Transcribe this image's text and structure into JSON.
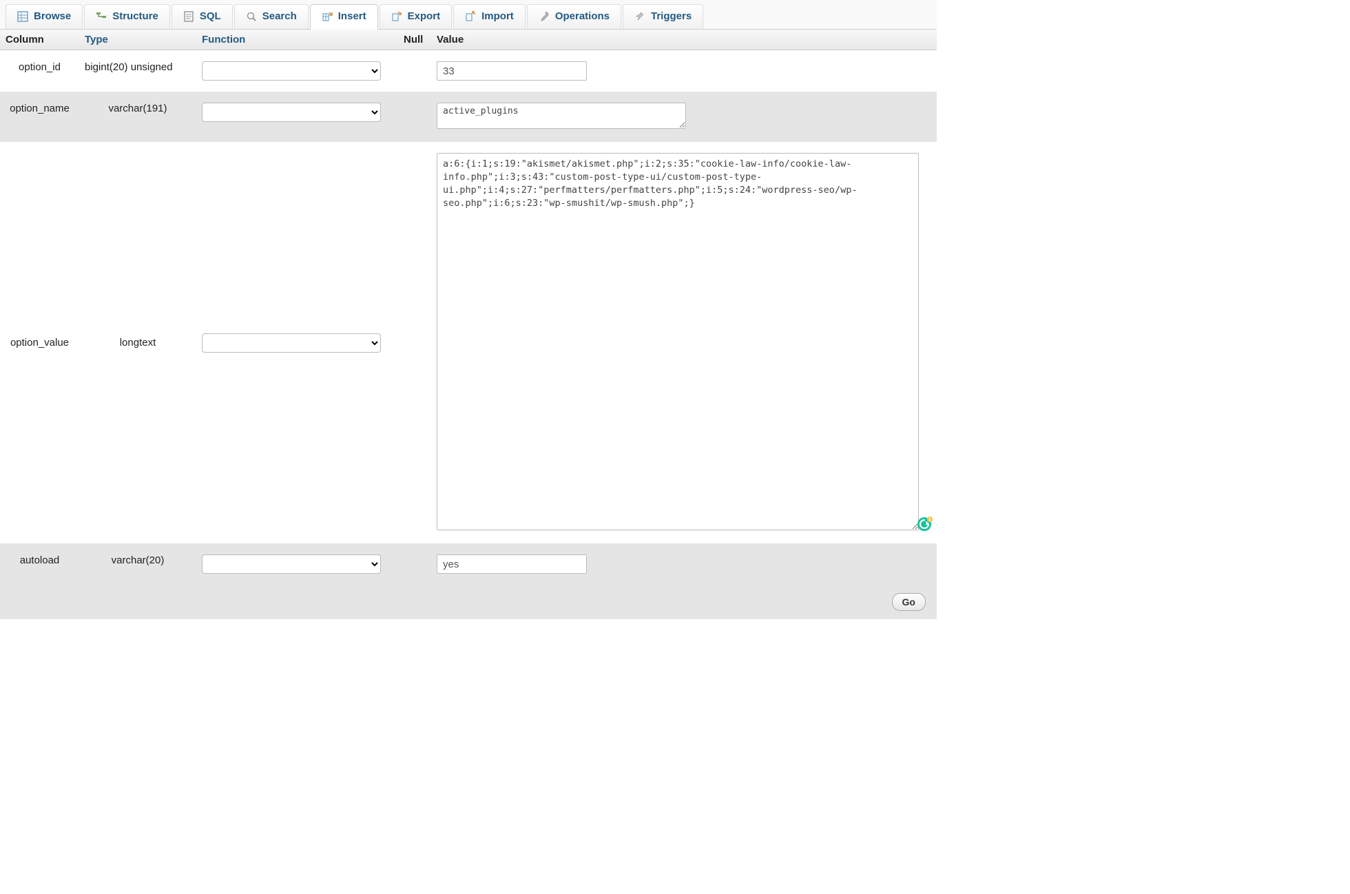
{
  "tabs": [
    {
      "label": "Browse"
    },
    {
      "label": "Structure"
    },
    {
      "label": "SQL"
    },
    {
      "label": "Search"
    },
    {
      "label": "Insert"
    },
    {
      "label": "Export"
    },
    {
      "label": "Import"
    },
    {
      "label": "Operations"
    },
    {
      "label": "Triggers"
    }
  ],
  "headers": {
    "column": "Column",
    "type": "Type",
    "function": "Function",
    "null": "Null",
    "value": "Value"
  },
  "rows": {
    "option_id": {
      "column": "option_id",
      "type": "bigint(20) unsigned",
      "value": "33"
    },
    "option_name": {
      "column": "option_name",
      "type": "varchar(191)",
      "value": "active_plugins"
    },
    "option_value": {
      "column": "option_value",
      "type": "longtext",
      "value": "a:6:{i:1;s:19:\"akismet/akismet.php\";i:2;s:35:\"cookie-law-info/cookie-law-info.php\";i:3;s:43:\"custom-post-type-ui/custom-post-type-ui.php\";i:4;s:27:\"perfmatters/perfmatters.php\";i:5;s:24:\"wordpress-seo/wp-seo.php\";i:6;s:23:\"wp-smushit/wp-smush.php\";}"
    },
    "autoload": {
      "column": "autoload",
      "type": "varchar(20)",
      "value": "yes"
    }
  },
  "footer": {
    "go": "Go"
  }
}
